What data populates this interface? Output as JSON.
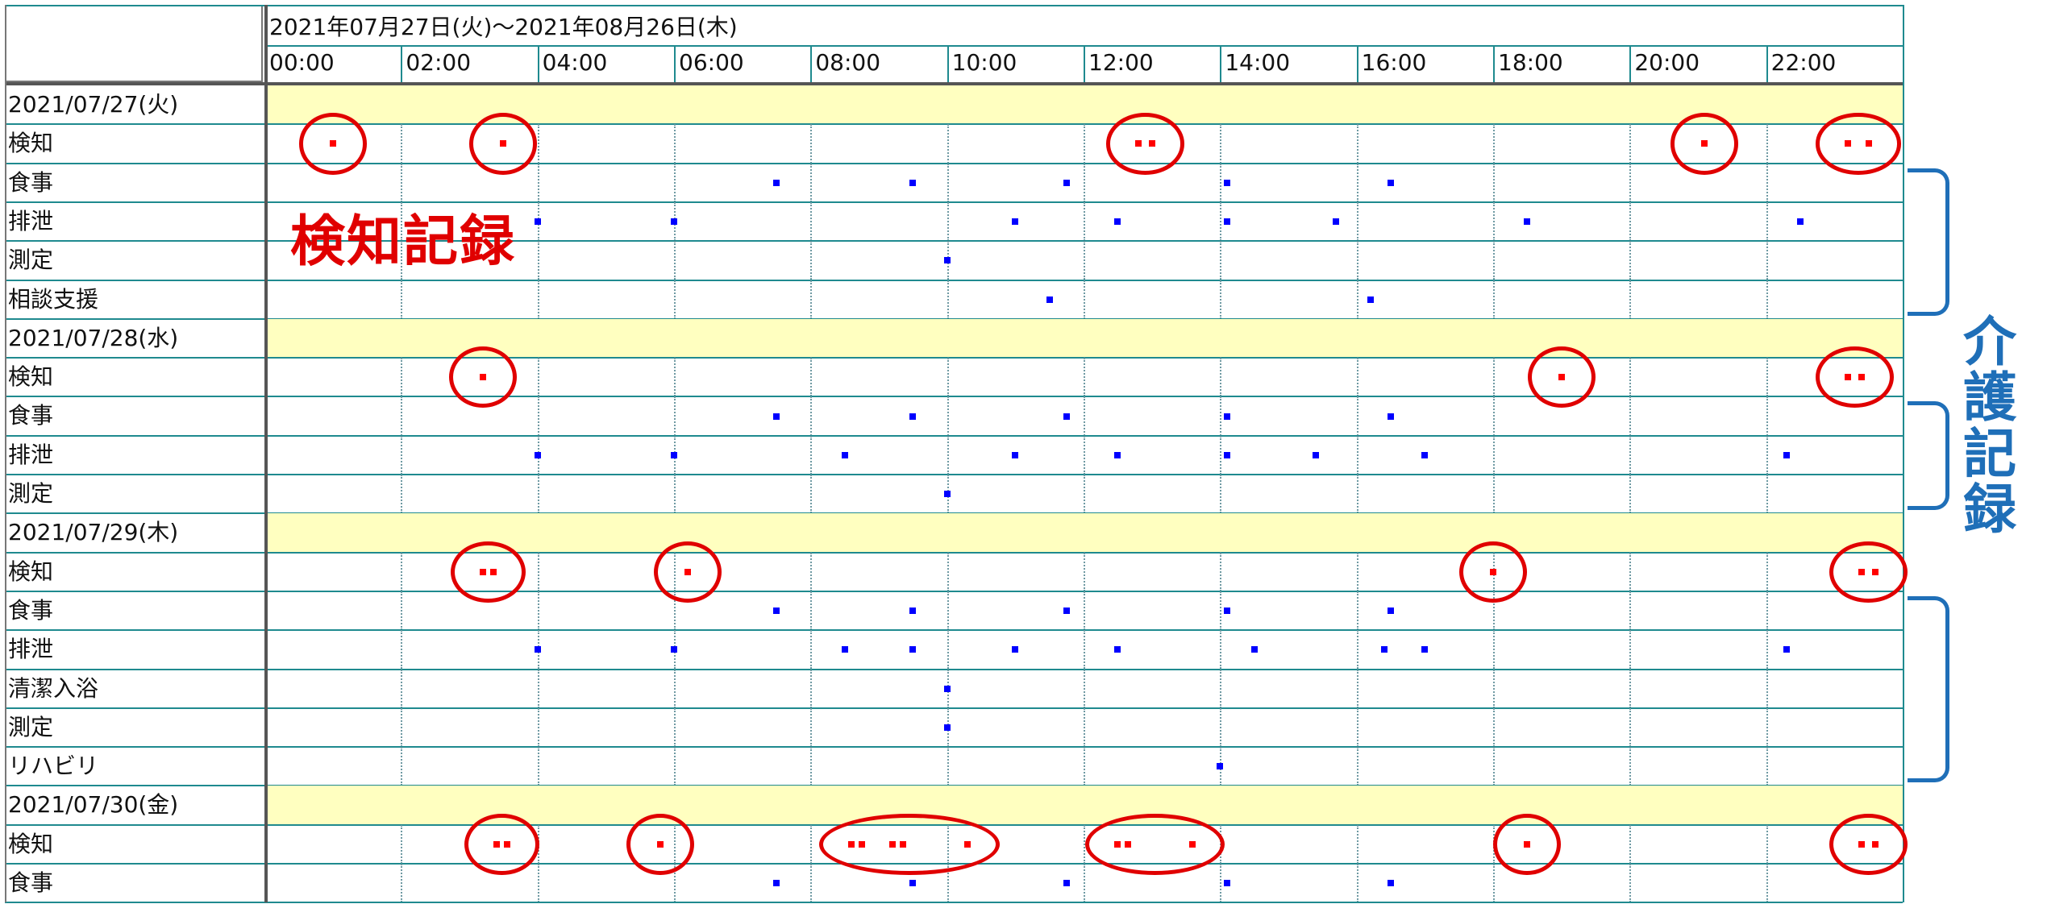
{
  "header": {
    "range_text": "2021年07月27日(火)～2021年08月26日(木)",
    "hours": [
      "00:00",
      "02:00",
      "04:00",
      "06:00",
      "08:00",
      "10:00",
      "12:00",
      "14:00",
      "16:00",
      "18:00",
      "20:00",
      "22:00"
    ]
  },
  "days": [
    {
      "date": "2021/07/27(火)",
      "rows": [
        {
          "label": "検知",
          "kind": "detect",
          "events": [
            1.0,
            3.5,
            12.8,
            13.0,
            21.1,
            23.2,
            23.5
          ]
        },
        {
          "label": "食事",
          "kind": "care",
          "events": [
            7.5,
            9.5,
            11.75,
            14.1,
            16.5
          ]
        },
        {
          "label": "排泄",
          "kind": "care",
          "events": [
            4.0,
            6.0,
            11.0,
            12.5,
            14.1,
            15.7,
            18.5,
            22.5
          ]
        },
        {
          "label": "測定",
          "kind": "care",
          "events": [
            10.0
          ]
        },
        {
          "label": "相談支援",
          "kind": "care",
          "events": [
            11.5,
            16.2
          ]
        }
      ]
    },
    {
      "date": "2021/07/28(水)",
      "rows": [
        {
          "label": "検知",
          "kind": "detect",
          "events": [
            3.2,
            19.0,
            23.2,
            23.4
          ]
        },
        {
          "label": "食事",
          "kind": "care",
          "events": [
            7.5,
            9.5,
            11.75,
            14.1,
            16.5
          ]
        },
        {
          "label": "排泄",
          "kind": "care",
          "events": [
            4.0,
            6.0,
            8.5,
            11.0,
            12.5,
            14.1,
            15.4,
            17.0,
            22.3
          ]
        },
        {
          "label": "測定",
          "kind": "care",
          "events": [
            10.0
          ]
        }
      ]
    },
    {
      "date": "2021/07/29(木)",
      "rows": [
        {
          "label": "検知",
          "kind": "detect",
          "events": [
            3.2,
            3.35,
            6.2,
            18.0,
            23.4,
            23.6
          ]
        },
        {
          "label": "食事",
          "kind": "care",
          "events": [
            7.5,
            9.5,
            11.75,
            14.1,
            16.5
          ]
        },
        {
          "label": "排泄",
          "kind": "care",
          "events": [
            4.0,
            6.0,
            8.5,
            9.5,
            11.0,
            12.5,
            14.5,
            16.4,
            17.0,
            22.3
          ]
        },
        {
          "label": "清潔入浴",
          "kind": "care",
          "events": [
            10.0
          ]
        },
        {
          "label": "測定",
          "kind": "care",
          "events": [
            10.0
          ]
        },
        {
          "label": "リハビリ",
          "kind": "care",
          "events": [
            14.0
          ]
        }
      ]
    },
    {
      "date": "2021/07/30(金)",
      "rows": [
        {
          "label": "検知",
          "kind": "detect",
          "events": [
            3.4,
            3.55,
            5.8,
            8.6,
            8.75,
            9.2,
            9.35,
            10.3,
            12.5,
            12.65,
            13.6,
            18.5,
            23.4,
            23.6
          ]
        },
        {
          "label": "食事",
          "kind": "care",
          "events": [
            7.5,
            9.5,
            11.75,
            14.1,
            16.5
          ]
        }
      ]
    }
  ],
  "annotations": {
    "detect_label": "検知記録",
    "care_label": "介護記録"
  },
  "colors": {
    "grid": "#1f8a8f",
    "date_band": "#ffffc0",
    "detect_dot": "#ff0000",
    "care_dot": "#0000ff",
    "annotation_red": "#e00000",
    "annotation_blue": "#1f6fb8"
  }
}
